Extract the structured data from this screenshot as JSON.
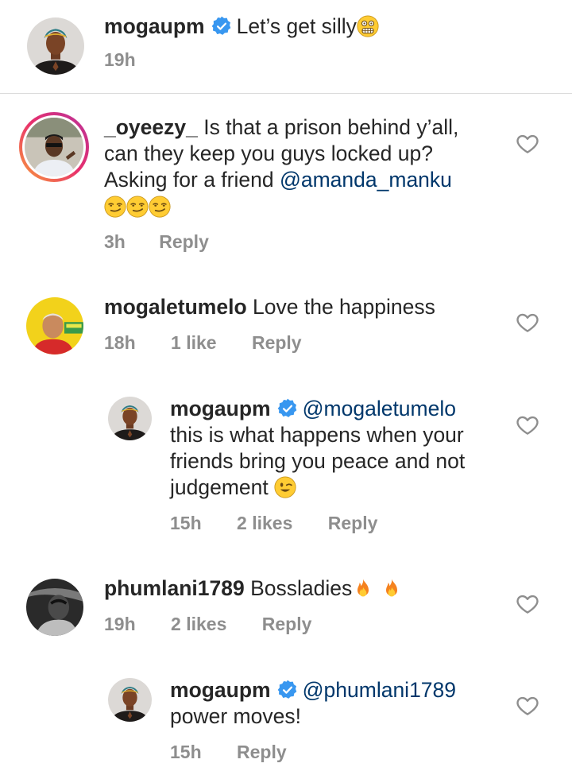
{
  "comments": [
    {
      "username": "mogaupm",
      "verified": true,
      "text": "Let’s get silly",
      "time": "19h"
    },
    {
      "username": "_oyeezy_",
      "text_line1": "Is that a prison behind y’all,",
      "text_line2": "can they keep you guys locked up?",
      "text_line3": "Asking for a friend",
      "mention": "@amanda_manku",
      "time": "3h",
      "reply": "Reply"
    },
    {
      "username": "mogaletumelo",
      "text": "Love the happiness",
      "time": "18h",
      "likes": "1 like",
      "reply": "Reply"
    },
    {
      "username": "mogaupm",
      "verified": true,
      "mention": "@mogaletumelo",
      "text_line1": "this is what happens when your",
      "text_line2": "friends bring you peace and not",
      "text_line3": "judgement",
      "time": "15h",
      "likes": "2 likes",
      "reply": "Reply"
    },
    {
      "username": "phumlani1789",
      "text": "Bossladies",
      "time": "19h",
      "likes": "2 likes",
      "reply": "Reply"
    },
    {
      "username": "mogaupm",
      "verified": true,
      "mention": "@phumlani1789",
      "text_line1": "power moves!",
      "time": "15h",
      "reply": "Reply"
    }
  ],
  "colors": {
    "verified": "#3897f0",
    "mention": "#00376b",
    "meta": "#8e8e8e",
    "divider": "#dbdbdb"
  },
  "icons": [
    "verified-badge-icon",
    "heart-icon",
    "grimacing-emoji",
    "smirk-emoji",
    "wink-emoji",
    "fire-emoji"
  ]
}
